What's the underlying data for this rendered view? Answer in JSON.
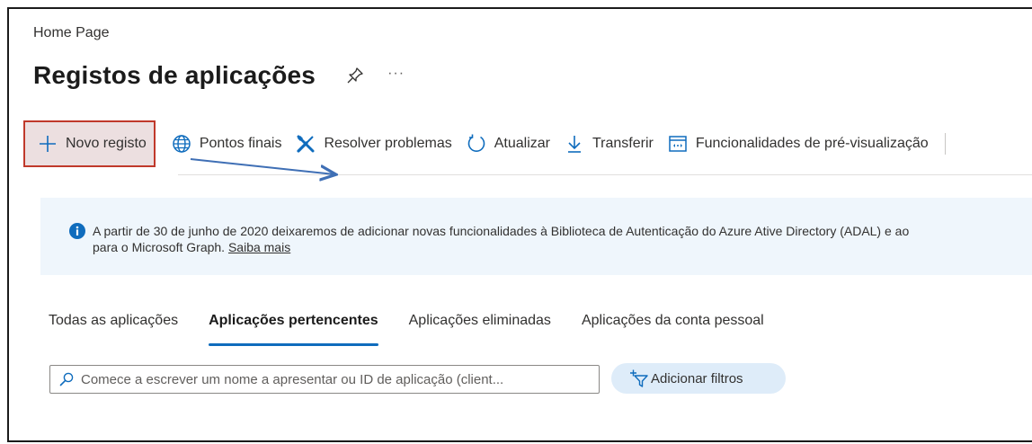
{
  "breadcrumb": "Home Page",
  "page_title": "Registos de aplicações",
  "more_label": "···",
  "toolbar": {
    "new_registration": "Novo registo",
    "endpoints": "Pontos finais",
    "troubleshoot": "Resolver problemas",
    "refresh": "Atualizar",
    "download": "Transferir",
    "preview_features": "Funcionalidades de pré-visualização"
  },
  "banner": {
    "line1": "A partir de 30 de junho de 2020 deixaremos de adicionar novas funcionalidades à Biblioteca de Autenticação do Azure Ative Directory (ADAL) e ao",
    "line2": "para o Microsoft Graph.",
    "link": "Saiba mais"
  },
  "tabs": [
    {
      "label": "Todas as aplicações",
      "active": false
    },
    {
      "label": "Aplicações pertencentes",
      "active": true
    },
    {
      "label": "Aplicações eliminadas",
      "active": false
    },
    {
      "label": "Aplicações da conta pessoal",
      "active": false
    }
  ],
  "search": {
    "placeholder": "Comece a escrever um nome a apresentar ou ID de aplicação (client..."
  },
  "add_filters": "Adicionar filtros",
  "colors": {
    "accent": "#0f6cbd",
    "highlight_border": "#c0392b",
    "arrow": "#3f6fb5",
    "banner_bg": "#eff6fc"
  }
}
